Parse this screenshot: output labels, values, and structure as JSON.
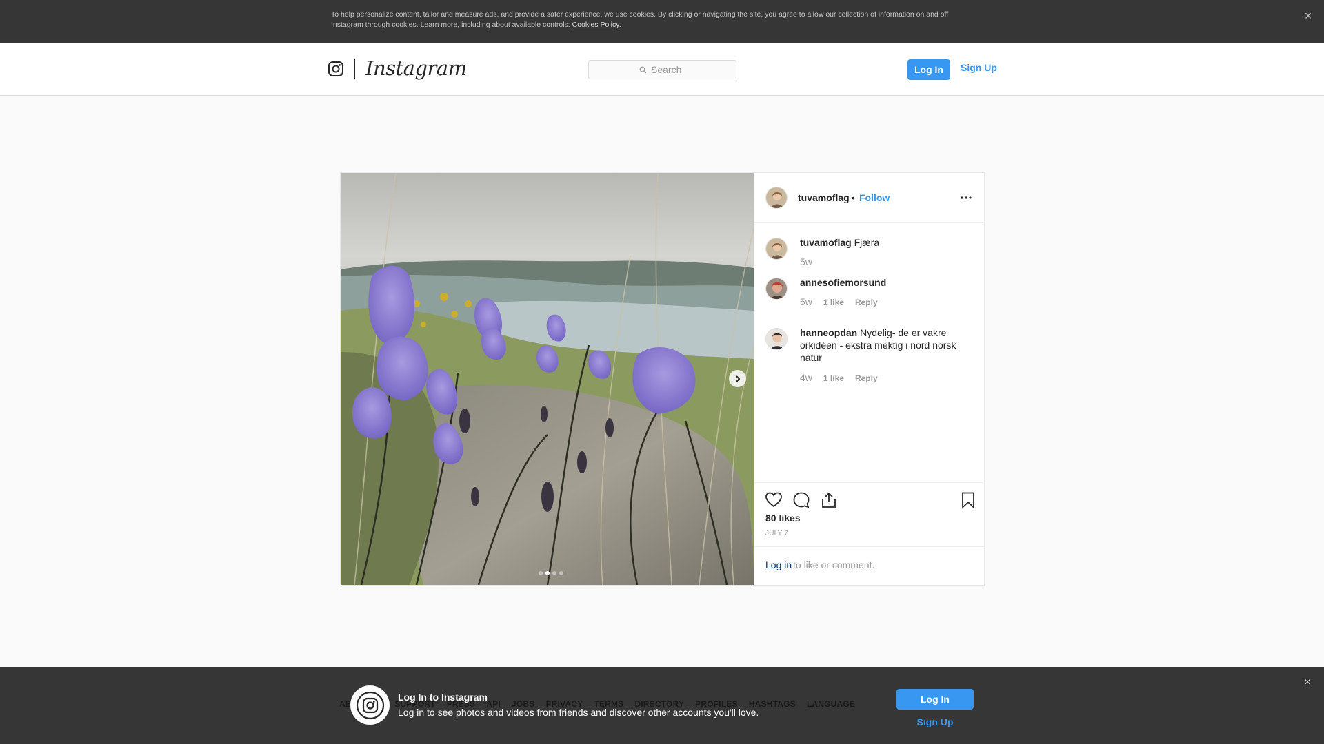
{
  "cookie_banner": {
    "text": "To help personalize content, tailor and measure ads, and provide a safer experience, we use cookies. By clicking or navigating the site, you agree to allow our collection of information on and off Instagram through cookies. Learn more, including about available controls: ",
    "link": "Cookies Policy",
    "period": ".",
    "close": "×"
  },
  "header": {
    "wordmark": "Instagram",
    "search_placeholder": "Search",
    "login": "Log In",
    "signup": "Sign Up"
  },
  "post": {
    "username": "tuvamoflag",
    "separator": "•",
    "follow": "Follow",
    "photo_icons": {
      "next": "chevron-right-icon"
    },
    "carousel_dots": 4,
    "carousel_active": 1,
    "comments": [
      {
        "user": "tuvamoflag",
        "text": "Fjæra ",
        "time": "5w",
        "likes": "",
        "reply": ""
      },
      {
        "user": "annesofiemorsund",
        "text": "",
        "time": "5w",
        "likes": "1 like",
        "reply": "Reply"
      },
      {
        "user": "hanneopdan",
        "text": "Nydelig- de er vakre orkidéen - ekstra mektig i nord norsk natur   ",
        "time": "4w",
        "likes": "1 like",
        "reply": "Reply"
      }
    ],
    "likes": "80 likes",
    "date": "JULY 7",
    "login_link": "Log in",
    "login_suffix": " to like or comment."
  },
  "footer": {
    "links": [
      "ABOUT US",
      "SUPPORT",
      "PRESS",
      "API",
      "JOBS",
      "PRIVACY",
      "TERMS",
      "DIRECTORY",
      "PROFILES",
      "HASHTAGS",
      "LANGUAGE"
    ]
  },
  "login_banner": {
    "title": "Log In to Instagram",
    "subtitle": "Log in to see photos and videos from friends and discover other accounts you'll love.",
    "login": "Log In",
    "signup": "Sign Up",
    "close": "×"
  },
  "colors": {
    "accent": "#3897f0",
    "dark_banner": "#363636",
    "border": "#dbdbdb"
  }
}
